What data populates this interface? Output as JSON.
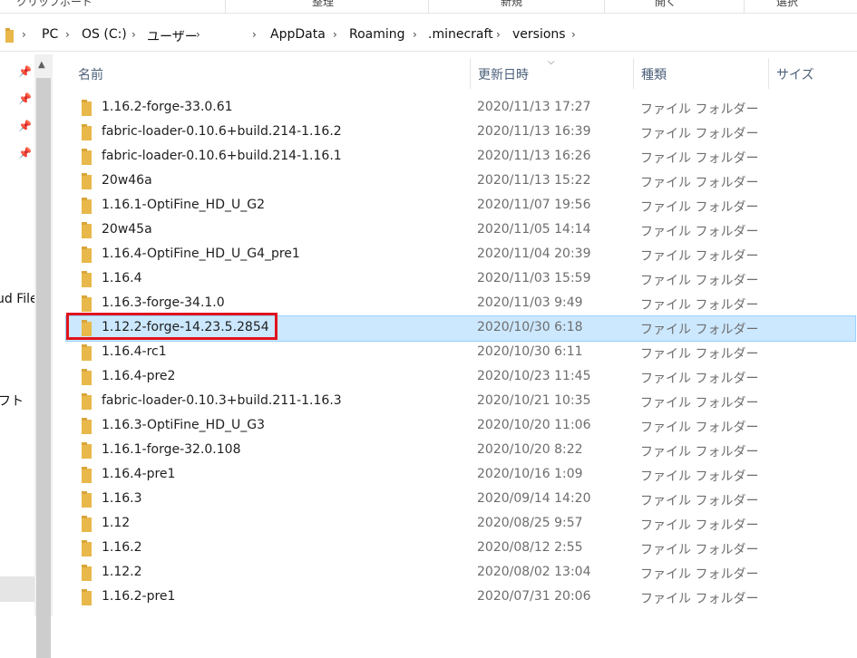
{
  "ribbon": {
    "groups": [
      "クリップボード",
      "整理",
      "新規",
      "開く",
      "選択"
    ]
  },
  "address_bar": {
    "crumbs": [
      "PC",
      "OS (C:)",
      "ユーザー",
      "AppData",
      "Roaming",
      ".minecraft",
      "versions"
    ]
  },
  "nav_pane": {
    "labels": [
      "ud File",
      "フト"
    ]
  },
  "columns": {
    "name": "名前",
    "date": "更新日時",
    "type": "種類",
    "size": "サイズ"
  },
  "files": [
    {
      "name": "1.16.2-forge-33.0.61",
      "date": "2020/11/13 17:27",
      "type": "ファイル フォルダー"
    },
    {
      "name": "fabric-loader-0.10.6+build.214-1.16.2",
      "date": "2020/11/13 16:39",
      "type": "ファイル フォルダー"
    },
    {
      "name": "fabric-loader-0.10.6+build.214-1.16.1",
      "date": "2020/11/13 16:26",
      "type": "ファイル フォルダー"
    },
    {
      "name": "20w46a",
      "date": "2020/11/13 15:22",
      "type": "ファイル フォルダー"
    },
    {
      "name": "1.16.1-OptiFine_HD_U_G2",
      "date": "2020/11/07 19:56",
      "type": "ファイル フォルダー"
    },
    {
      "name": "20w45a",
      "date": "2020/11/05 14:14",
      "type": "ファイル フォルダー"
    },
    {
      "name": "1.16.4-OptiFine_HD_U_G4_pre1",
      "date": "2020/11/04 20:39",
      "type": "ファイル フォルダー"
    },
    {
      "name": "1.16.4",
      "date": "2020/11/03 15:59",
      "type": "ファイル フォルダー"
    },
    {
      "name": "1.16.3-forge-34.1.0",
      "date": "2020/11/03 9:49",
      "type": "ファイル フォルダー"
    },
    {
      "name": "1.12.2-forge-14.23.5.2854",
      "date": "2020/10/30 6:18",
      "type": "ファイル フォルダー",
      "selected": true
    },
    {
      "name": "1.16.4-rc1",
      "date": "2020/10/30 6:11",
      "type": "ファイル フォルダー"
    },
    {
      "name": "1.16.4-pre2",
      "date": "2020/10/23 11:45",
      "type": "ファイル フォルダー"
    },
    {
      "name": "fabric-loader-0.10.3+build.211-1.16.3",
      "date": "2020/10/21 10:35",
      "type": "ファイル フォルダー"
    },
    {
      "name": "1.16.3-OptiFine_HD_U_G3",
      "date": "2020/10/20 11:06",
      "type": "ファイル フォルダー"
    },
    {
      "name": "1.16.1-forge-32.0.108",
      "date": "2020/10/20 8:22",
      "type": "ファイル フォルダー"
    },
    {
      "name": "1.16.4-pre1",
      "date": "2020/10/16 1:09",
      "type": "ファイル フォルダー"
    },
    {
      "name": "1.16.3",
      "date": "2020/09/14 14:20",
      "type": "ファイル フォルダー"
    },
    {
      "name": "1.12",
      "date": "2020/08/25 9:57",
      "type": "ファイル フォルダー"
    },
    {
      "name": "1.16.2",
      "date": "2020/08/12 2:55",
      "type": "ファイル フォルダー"
    },
    {
      "name": "1.12.2",
      "date": "2020/08/02 13:04",
      "type": "ファイル フォルダー"
    },
    {
      "name": "1.16.2-pre1",
      "date": "2020/07/31 20:06",
      "type": "ファイル フォルダー"
    }
  ],
  "colors": {
    "selection_bg": "#cce8ff",
    "highlight_box": "#e0141e",
    "folder": "#e8b84a"
  }
}
